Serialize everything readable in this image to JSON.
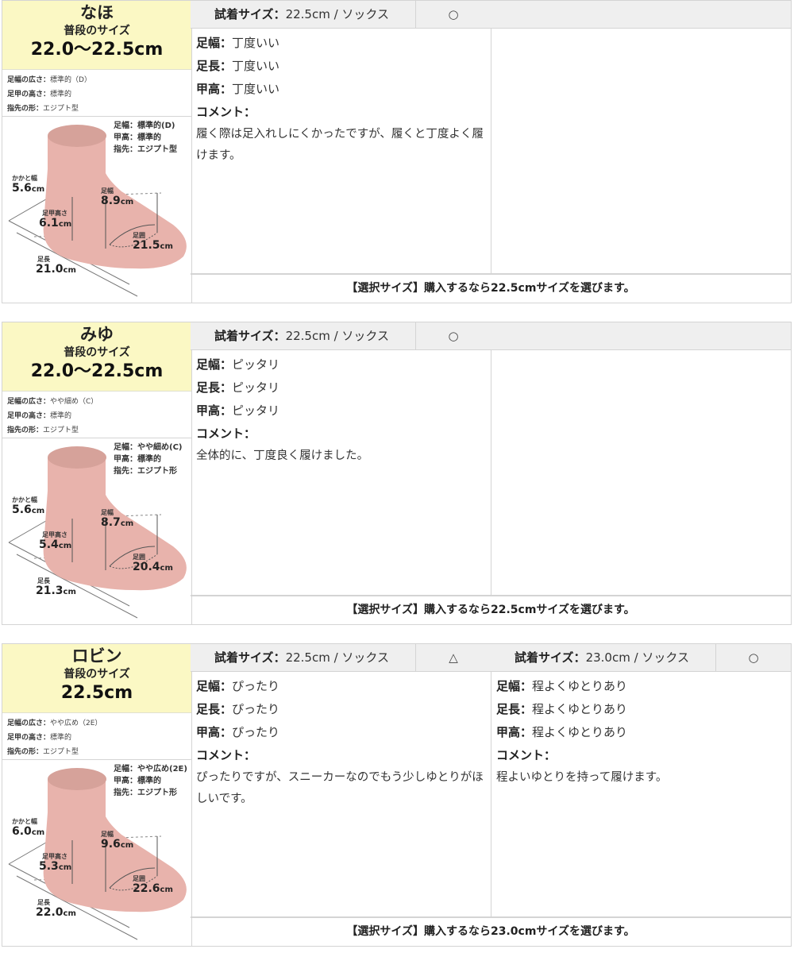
{
  "cards": [
    {
      "name": "なほ",
      "usual_label": "普段のサイズ",
      "usual_size": "22.0〜22.5cm",
      "attrs": [
        {
          "label": "足幅の広さ：",
          "value": "標準的（D）"
        },
        {
          "label": "足甲の高さ：",
          "value": "標準的"
        },
        {
          "label": "指先の形：",
          "value": "エジプト型"
        }
      ],
      "foot": {
        "legend": [
          "足幅：標準的(D)",
          "甲高：標準的",
          "指先：エジプト型"
        ],
        "heel_label": "かかと幅",
        "heel": "5.6",
        "unit": "cm",
        "instep_label": "足甲高さ",
        "instep": "6.1",
        "width_label": "足幅",
        "width": "8.9",
        "girth_label": "足囲",
        "girth": "21.5",
        "length_label": "足長",
        "length": "21.0"
      },
      "trials": [
        {
          "size_label": "試着サイズ：",
          "size_value": "22.5cm / ソックス",
          "mark": "○",
          "rows": [
            {
              "label": "足幅：",
              "value": "丁度いい"
            },
            {
              "label": "足長：",
              "value": "丁度いい"
            },
            {
              "label": "甲高：",
              "value": "丁度いい"
            }
          ],
          "comment_label": "コメント：",
          "comment": "履く際は足入れしにくかったですが、履くと丁度よく履けます。"
        }
      ],
      "selection": "【選択サイズ】購入するなら22.5cmサイズを選びます。"
    },
    {
      "name": "みゆ",
      "usual_label": "普段のサイズ",
      "usual_size": "22.0〜22.5cm",
      "attrs": [
        {
          "label": "足幅の広さ：",
          "value": "やや細め（C）"
        },
        {
          "label": "足甲の高さ：",
          "value": "標準的"
        },
        {
          "label": "指先の形：",
          "value": "エジプト型"
        }
      ],
      "foot": {
        "legend": [
          "足幅：やや細め(C)",
          "甲高：標準的",
          "指先：エジプト形"
        ],
        "heel_label": "かかと幅",
        "heel": "5.6",
        "unit": "cm",
        "instep_label": "足甲高さ",
        "instep": "5.4",
        "width_label": "足幅",
        "width": "8.7",
        "girth_label": "足囲",
        "girth": "20.4",
        "length_label": "足長",
        "length": "21.3"
      },
      "trials": [
        {
          "size_label": "試着サイズ：",
          "size_value": "22.5cm / ソックス",
          "mark": "○",
          "rows": [
            {
              "label": "足幅：",
              "value": "ピッタリ"
            },
            {
              "label": "足長：",
              "value": "ピッタリ"
            },
            {
              "label": "甲高：",
              "value": "ピッタリ"
            }
          ],
          "comment_label": "コメント：",
          "comment": "全体的に、丁度良く履けました。"
        }
      ],
      "selection": "【選択サイズ】購入するなら22.5cmサイズを選びます。"
    },
    {
      "name": "ロビン",
      "usual_label": "普段のサイズ",
      "usual_size": "22.5cm",
      "attrs": [
        {
          "label": "足幅の広さ：",
          "value": "やや広め（2E）"
        },
        {
          "label": "足甲の高さ：",
          "value": "標準的"
        },
        {
          "label": "指先の形：",
          "value": "エジプト型"
        }
      ],
      "foot": {
        "legend": [
          "足幅：やや広め(2E)",
          "甲高：標準的",
          "指先：エジプト形"
        ],
        "heel_label": "かかと幅",
        "heel": "6.0",
        "unit": "cm",
        "instep_label": "足甲高さ",
        "instep": "5.3",
        "width_label": "足幅",
        "width": "9.6",
        "girth_label": "足囲",
        "girth": "22.6",
        "length_label": "足長",
        "length": "22.0"
      },
      "trials": [
        {
          "size_label": "試着サイズ：",
          "size_value": "22.5cm / ソックス",
          "mark": "△",
          "rows": [
            {
              "label": "足幅：",
              "value": "ぴったり"
            },
            {
              "label": "足長：",
              "value": "ぴったり"
            },
            {
              "label": "甲高：",
              "value": "ぴったり"
            }
          ],
          "comment_label": "コメント：",
          "comment": "ぴったりですが、スニーカーなのでもう少しゆとりがほしいです。"
        },
        {
          "size_label": "試着サイズ：",
          "size_value": "23.0cm / ソックス",
          "mark": "○",
          "rows": [
            {
              "label": "足幅：",
              "value": "程よくゆとりあり"
            },
            {
              "label": "足長：",
              "value": "程よくゆとりあり"
            },
            {
              "label": "甲高：",
              "value": "程よくゆとりあり"
            }
          ],
          "comment_label": "コメント：",
          "comment": "程よいゆとりを持って履けます。"
        }
      ],
      "selection": "【選択サイズ】購入するなら23.0cmサイズを選びます。"
    }
  ]
}
